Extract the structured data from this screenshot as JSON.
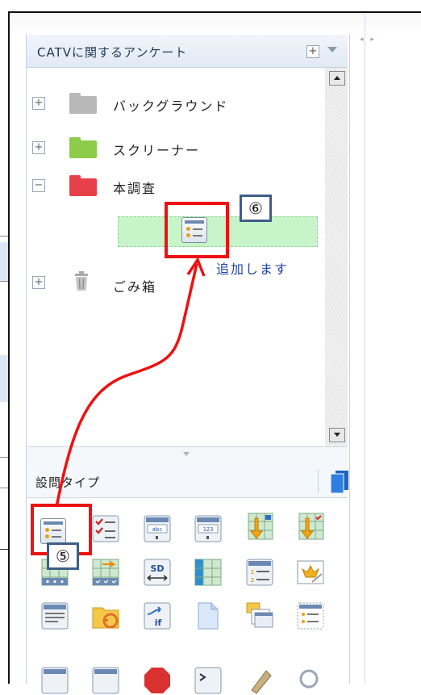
{
  "panel": {
    "title": "CATVに関するアンケート"
  },
  "tree": {
    "items": [
      {
        "label": "バックグラウンド",
        "toggle": "+",
        "folder_color": "#b8b8b8"
      },
      {
        "label": "スクリーナー",
        "toggle": "+",
        "folder_color": "#8ccc4a"
      },
      {
        "label": "本調査",
        "toggle": "−",
        "folder_color": "#e8404a"
      },
      {
        "label": "ごみ箱",
        "toggle": "+",
        "icon": "trash-icon"
      }
    ],
    "add_hint": "追加します"
  },
  "annotations": {
    "step5": "⑤",
    "step6": "⑥",
    "arrow_color": "#ee1111"
  },
  "question_types": {
    "title": "設問タイプ",
    "icons": [
      "single-answer-icon",
      "multiple-answer-icon",
      "text-answer-icon",
      "number-answer-icon",
      "matrix-sort-icon",
      "matrix-check-sort-icon",
      "matrix-single-icon",
      "matrix-multi-icon",
      "sd-scale-icon",
      "table-grid-icon",
      "ranking-icon",
      "image-crown-icon",
      "free-text-icon",
      "folder-cycle-icon",
      "branch-if-icon",
      "blank-page-icon",
      "page-stack-icon",
      "list-dotted-icon",
      "more-icon-1",
      "more-icon-2",
      "stop-icon",
      "script-icon",
      "image-edit-icon",
      "search-icon"
    ]
  },
  "colors": {
    "accent_blue": "#2f6fc0",
    "badge_border": "#3d5f86",
    "highlight_green": "#c7f5c9"
  }
}
